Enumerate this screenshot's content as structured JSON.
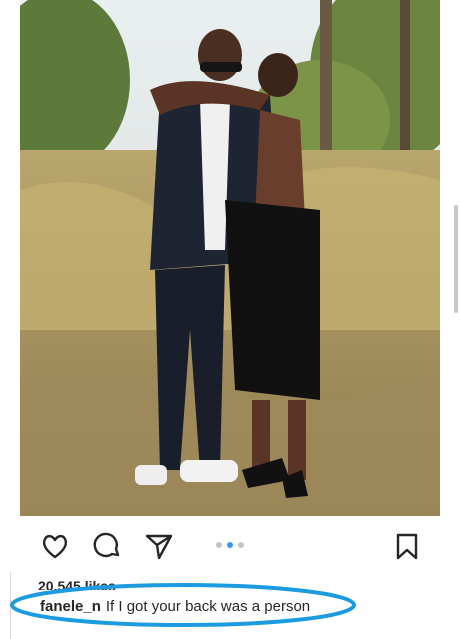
{
  "post": {
    "image_icon": "couple-photo",
    "likes_text": "20,545 likes",
    "caption": {
      "username": "fanele_n",
      "text": "If I got your back was a person"
    }
  },
  "actions": {
    "like_icon": "heart-icon",
    "comment_icon": "comment-icon",
    "share_icon": "paper-plane-icon",
    "save_icon": "bookmark-icon"
  },
  "carousel": {
    "count": 3,
    "active_index": 1
  },
  "colors": {
    "accent": "#3897f0",
    "highlight": "#1d9be0",
    "text": "#262626"
  }
}
